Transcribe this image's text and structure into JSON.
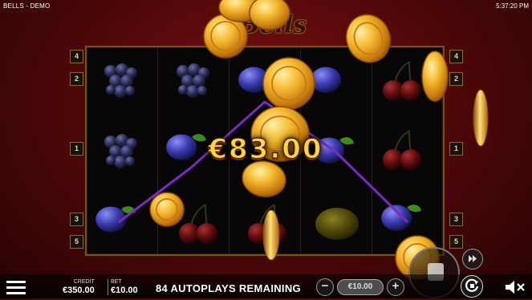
{
  "topbar": {
    "title": "BELLS - DEMO",
    "clock": "5:37:20 PM"
  },
  "logo": {
    "text": "Bells"
  },
  "paylines_left": [
    "4",
    "2",
    "1",
    "3",
    "5"
  ],
  "paylines_right": [
    "4",
    "2",
    "1",
    "3",
    "5"
  ],
  "reels": {
    "columns": [
      [
        "grapes",
        "grapes",
        "plum"
      ],
      [
        "grapes",
        "plum",
        "cherries"
      ],
      [
        "plum",
        "plum",
        "cherries"
      ],
      [
        "plum",
        "plum",
        "lemon"
      ],
      [
        "cherries",
        "cherries",
        "plum"
      ]
    ]
  },
  "win": {
    "amount": "€83.00"
  },
  "bottom": {
    "credit_label": "CREDIT",
    "credit_value": "€350.00",
    "bet_label": "BET",
    "bet_value": "€10.00",
    "autoplays_text": "84 AUTOPLAYS REMAINING",
    "bet_display": "€10.00",
    "minus_label": "−",
    "plus_label": "+"
  },
  "icons": {
    "menu": "hamburger-menu-icon",
    "fast_forward": "fast-forward-icon",
    "autoplay_stop": "stop-icon",
    "autoplay": "autoplay-icon",
    "sound": "sound-muted-icon",
    "coins": "gold-coin-icon"
  },
  "colors": {
    "background": "#4a0708",
    "win_text": "#ffd24a",
    "payline": "#7a2bbf",
    "frame": "#6e5520"
  }
}
